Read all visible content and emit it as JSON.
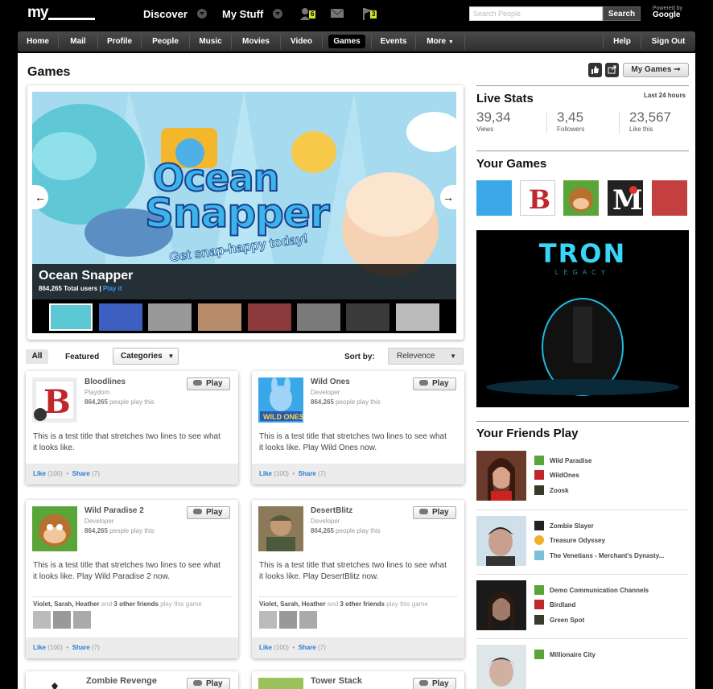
{
  "topbar": {
    "logo": "my",
    "discover": "Discover",
    "mystuff": "My Stuff",
    "friend_requests": "6",
    "notifications": "3",
    "search_placeholder": "Search People",
    "search_button": "Search",
    "powered_by": "Powered by",
    "google": "Google"
  },
  "nav": {
    "items": [
      "Home",
      "Mail",
      "Profile",
      "People",
      "Music",
      "Movies",
      "Video",
      "Games",
      "Events",
      "More"
    ],
    "help": "Help",
    "signout": "Sign Out",
    "active": "Games"
  },
  "page": {
    "title": "Games",
    "mygames": "My Games"
  },
  "featured": {
    "title": "Ocean Snapper",
    "users": "864,265 Total users",
    "play": "Play it",
    "art_title_1": "Ocean",
    "art_title_2": "Snapper",
    "tagline": "Get snap-happy today!"
  },
  "filters": {
    "all": "All",
    "featured": "Featured",
    "categories": "Categories",
    "sort_label": "Sort by:",
    "sort_value": "Relevence"
  },
  "cards": [
    {
      "title": "Bloodlines",
      "dev": "Playdom",
      "users": "864,265",
      "users_suffix": "people play this",
      "play": "Play",
      "desc": "This is a test title that stretches two lines to see what it looks like.",
      "like": "Like",
      "like_count": "(100)",
      "share": "Share",
      "share_count": "(7)"
    },
    {
      "title": "Wild Ones",
      "dev": "Developer",
      "users": "864,265",
      "users_suffix": "people play this",
      "play": "Play",
      "desc": "This is a test title that stretches two lines to see what it looks like. Play Wild Ones now.",
      "like": "Like",
      "like_count": "(100)",
      "share": "Share",
      "share_count": "(7)"
    },
    {
      "title": "Wild Paradise 2",
      "dev": "Developer",
      "users": "864,265",
      "users_suffix": "people play this",
      "play": "Play",
      "desc": "This is a test title that stretches two lines to see what it looks like. Play Wild Paradise 2 now.",
      "friends": "Violet, Sarah, Heather",
      "and": "and",
      "others": "3 other friends",
      "play_suffix": "play this game",
      "like": "Like",
      "like_count": "(100)",
      "share": "Share",
      "share_count": "(7)"
    },
    {
      "title": "DesertBlitz",
      "dev": "Developer",
      "users": "864,265",
      "users_suffix": "people play this",
      "play": "Play",
      "desc": "This is a test title that stretches two lines to see what it looks like. Play DesertBlitz now.",
      "friends": "Violet, Sarah, Heather",
      "and": "and",
      "others": "3 other friends",
      "play_suffix": "play this game",
      "like": "Like",
      "like_count": "(100)",
      "share": "Share",
      "share_count": "(7)"
    },
    {
      "title": "Zombie Revenge",
      "play": "Play"
    },
    {
      "title": "Tower Stack",
      "play": "Play"
    }
  ],
  "live_stats": {
    "title": "Live Stats",
    "period": "Last 24 hours",
    "views": "39,34",
    "views_label": "Views",
    "followers": "3,45",
    "followers_label": "Followers",
    "likes": "23,567",
    "likes_label": "Like this"
  },
  "your_games": {
    "title": "Your Games"
  },
  "ad": {
    "title": "TRON",
    "sub": "LEGACY"
  },
  "friends_play": {
    "title": "Your Friends Play",
    "groups": [
      [
        "Wild Paradise",
        "WildOnes",
        "Zoosk"
      ],
      [
        "Zombie Slayer",
        "Treasure Odyssey",
        "The Venetians - Merchant's Dynasty..."
      ],
      [
        "Demo Communication Channels",
        "Birdland",
        "Green Spot"
      ],
      [
        "Millionaire City"
      ]
    ]
  },
  "colors": {
    "link": "#2a7bd6",
    "badge": "#d8e22a",
    "nav_bg": "#3a3a3a"
  }
}
